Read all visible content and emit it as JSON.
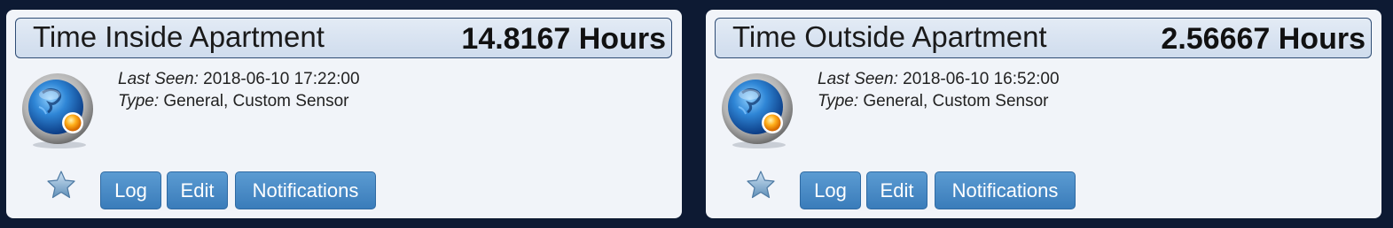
{
  "colors": {
    "page_background": "#0d1a33",
    "card_background": "#f1f4f9",
    "button": "#4a8cc8",
    "header_border": "#2f4d75"
  },
  "devices": [
    {
      "name": "Time Inside Apartment",
      "value": "14.8167 Hours",
      "last_seen_label": "Last Seen:",
      "last_seen": "2018-06-10 17:22:00",
      "type_label": "Type:",
      "type": "General, Custom Sensor",
      "icon": "custom-sensor-icon",
      "favorite_icon": "star-icon",
      "buttons": {
        "log": "Log",
        "edit": "Edit",
        "notifications": "Notifications"
      }
    },
    {
      "name": "Time Outside Apartment",
      "value": "2.56667 Hours",
      "last_seen_label": "Last Seen:",
      "last_seen": "2018-06-10 16:52:00",
      "type_label": "Type:",
      "type": "General, Custom Sensor",
      "icon": "custom-sensor-icon",
      "favorite_icon": "star-icon",
      "buttons": {
        "log": "Log",
        "edit": "Edit",
        "notifications": "Notifications"
      }
    }
  ]
}
